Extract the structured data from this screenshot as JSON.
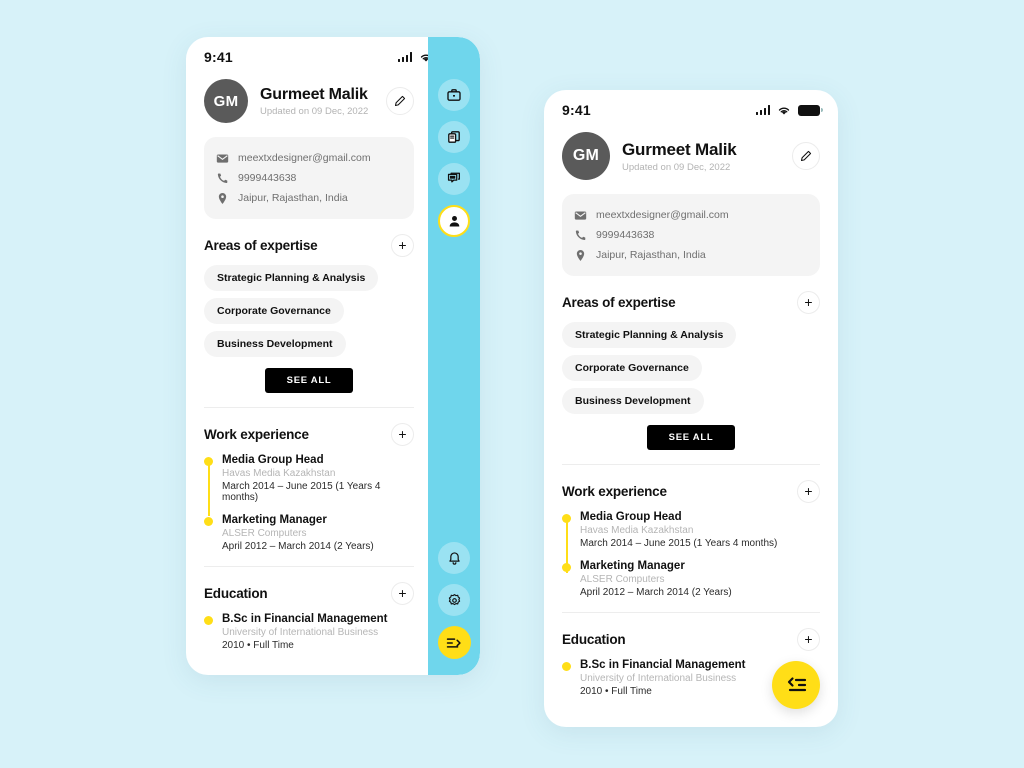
{
  "theme": {
    "page_bg": "#d7f2f9",
    "rail_bg": "#6fd6ec",
    "accent_yellow": "#ffde17",
    "avatar_bg": "#5a5a5a",
    "card_bg": "#f4f4f4",
    "black": "#000000"
  },
  "status": {
    "time": "9:41",
    "signal_icon": "signal-bars-icon",
    "wifi_icon": "wifi-icon",
    "battery_icon": "battery-full-icon"
  },
  "profile": {
    "initials": "GM",
    "name": "Gurmeet Malik",
    "updated": "Updated on 09 Dec, 2022",
    "edit_icon": "pencil-icon"
  },
  "contact": [
    {
      "icon": "mail-icon",
      "value": "meextxdesigner@gmail.com"
    },
    {
      "icon": "phone-icon",
      "value": "9999443638"
    },
    {
      "icon": "pin-icon",
      "value": "Jaipur, Rajasthan, India"
    }
  ],
  "expertise": {
    "title": "Areas of expertise",
    "add_label": "+",
    "chips": [
      "Strategic Planning & Analysis",
      "Corporate Governance",
      "Business Development"
    ],
    "see_all_label": "SEE ALL"
  },
  "work": {
    "title": "Work experience",
    "add_label": "+",
    "entries": [
      {
        "role": "Media Group Head",
        "company": "Havas Media Kazakhstan",
        "period": "March 2014 – June 2015 (1 Years 4 months)"
      },
      {
        "role": "Marketing Manager",
        "company": "ALSER Computers",
        "period": "April 2012 – March 2014 (2 Years)"
      }
    ]
  },
  "education": {
    "title": "Education",
    "add_label": "+",
    "entries": [
      {
        "degree": "B.Sc in Financial Management",
        "school": "University of International Business",
        "period": "2010  •  Full Time"
      }
    ]
  },
  "rail": {
    "top_items": [
      {
        "icon": "briefcase-icon",
        "active": false
      },
      {
        "icon": "documents-copy-icon",
        "active": false
      },
      {
        "icon": "chat-bubble-icon",
        "active": false
      },
      {
        "icon": "person-icon",
        "active": true
      }
    ],
    "bottom_items": [
      {
        "icon": "bell-icon"
      },
      {
        "icon": "gear-icon"
      }
    ],
    "fab_icon": "expand-menu-right-icon"
  },
  "right_phone": {
    "fab_icon": "collapse-menu-left-icon"
  }
}
